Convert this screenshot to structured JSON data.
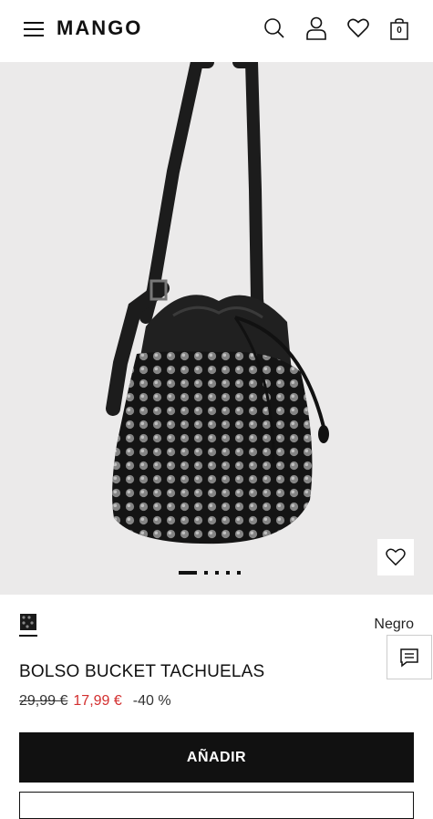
{
  "header": {
    "brand": "MANGO",
    "icons": [
      "menu-icon",
      "search-icon",
      "user-icon",
      "heart-icon",
      "bag-icon"
    ],
    "bag_count": "0"
  },
  "gallery": {
    "image_count": 5,
    "active_index": 0
  },
  "product": {
    "color_name": "Negro",
    "title": "BOLSO BUCKET TACHUELAS",
    "old_price": "29,99 €",
    "sale_price": "17,99 €",
    "discount": "-40 %",
    "add_button_label": "AÑADIR"
  },
  "colors": {
    "sale": "#d32f2f",
    "primary": "#111111",
    "gallery_bg": "#ebeaea"
  }
}
